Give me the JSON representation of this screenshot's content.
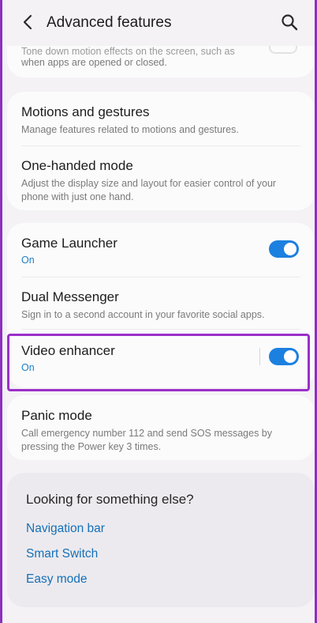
{
  "header": {
    "title": "Advanced features"
  },
  "top_partial": {
    "line1": "Tone down motion effects on the screen, such as",
    "line2": "when apps are opened or closed."
  },
  "motions": {
    "title": "Motions and gestures",
    "desc": "Manage features related to motions and gestures."
  },
  "one_handed": {
    "title": "One-handed mode",
    "desc": "Adjust the display size and layout for easier control of your phone with just one hand."
  },
  "game_launcher": {
    "title": "Game Launcher",
    "status": "On"
  },
  "dual_messenger": {
    "title": "Dual Messenger",
    "desc": "Sign in to a second account in your favorite social apps."
  },
  "video_enhancer": {
    "title": "Video enhancer",
    "status": "On"
  },
  "panic_mode": {
    "title": "Panic mode",
    "desc": "Call emergency number 112 and send SOS messages by pressing the Power key 3 times."
  },
  "looking": {
    "title": "Looking for something else?",
    "links": [
      "Navigation bar",
      "Smart Switch",
      "Easy mode"
    ]
  },
  "colors": {
    "accent": "#1c80e0",
    "highlight": "#9b2fc9",
    "link": "#1470b8"
  },
  "icons": {
    "back": "back-arrow-icon",
    "search": "search-icon"
  }
}
